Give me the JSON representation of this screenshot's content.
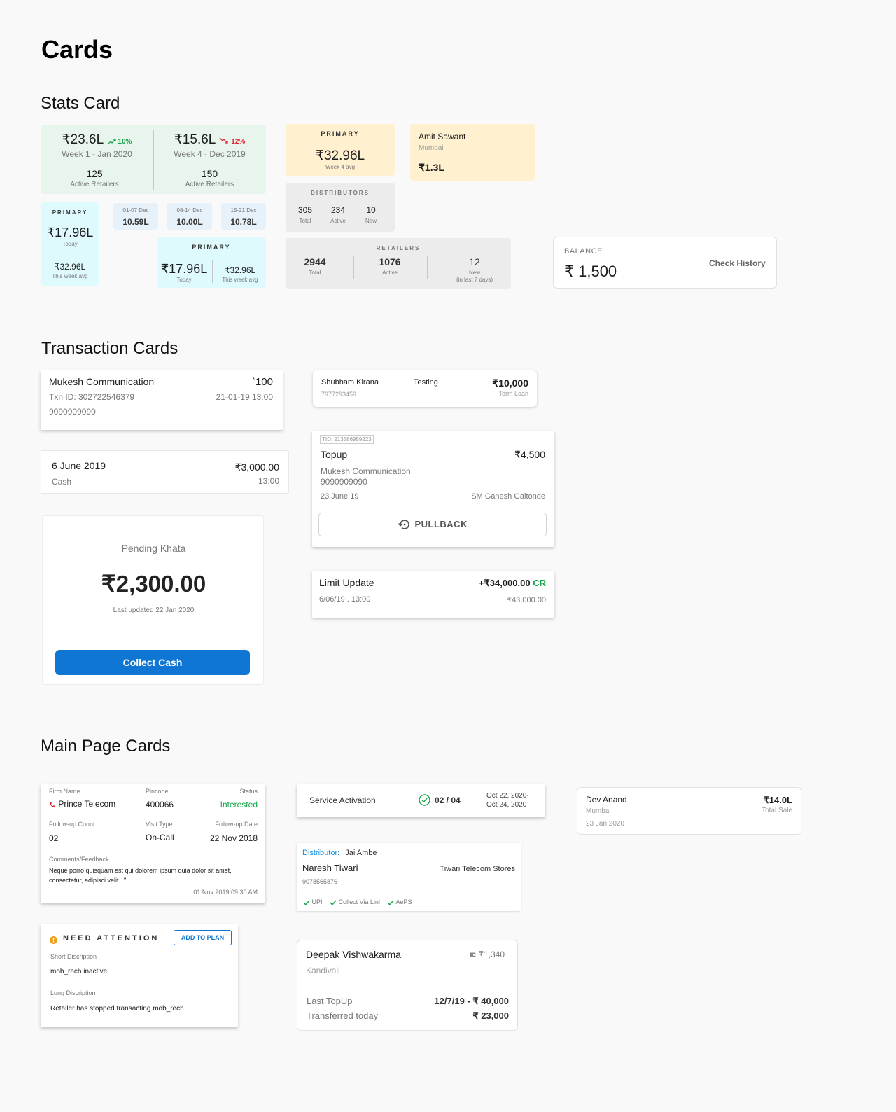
{
  "page": {
    "title": "Cards"
  },
  "sections": {
    "stats": "Stats Card",
    "transactions": "Transaction Cards",
    "main": "Main Page Cards"
  },
  "colors": {
    "accent": "#1076d3",
    "positive": "#14a348",
    "negative": "#e0202f"
  },
  "stats": {
    "week_compare": {
      "left": {
        "value": "₹23.6L",
        "delta": "10%",
        "period": "Week 1 - Jan 2020",
        "count": "125",
        "count_label": "Active Retailers"
      },
      "right": {
        "value": "₹15.6L",
        "delta": "12%",
        "period": "Week 4 - Dec 2019",
        "count": "150",
        "count_label": "Active Retailers"
      }
    },
    "primary_today": {
      "caption": "PRIMARY",
      "value": "₹17.96L",
      "sub": "Today",
      "avg_value": "₹32.96L",
      "avg_label": "This week avg"
    },
    "weekly_chips": [
      {
        "range": "01-07 Dec",
        "value": "10.59L"
      },
      {
        "range": "08-14 Dec",
        "value": "10.00L"
      },
      {
        "range": "15-21 Dec",
        "value": "10.78L"
      }
    ],
    "primary_compare": {
      "caption": "PRIMARY",
      "value": "₹17.96L",
      "sub": "Today",
      "avg_value": "₹32.96L",
      "avg_label": "This week avg"
    },
    "primary_week": {
      "caption": "PRIMARY",
      "value": "₹32.96L",
      "sub": "Week 4 avg"
    },
    "distributors": {
      "caption": "DISTRIBUTORS",
      "items": [
        {
          "value": "305",
          "label": "Total"
        },
        {
          "value": "234",
          "label": "Active"
        },
        {
          "value": "10",
          "label": "New"
        }
      ]
    },
    "retailers": {
      "caption": "RETAILERS",
      "items": [
        {
          "value": "2944",
          "label": "Total"
        },
        {
          "value": "1076",
          "label": "Active"
        },
        {
          "value": "12",
          "label": "New",
          "note": "(in last 7 days)"
        }
      ]
    },
    "person": {
      "name": "Amit Sawant",
      "city": "Mumbai",
      "value": "₹1.3L"
    },
    "balance": {
      "label": "BALANCE",
      "value": "₹ 1,500",
      "action": "Check History"
    }
  },
  "transactions": {
    "mukesh": {
      "name": "Mukesh Communication",
      "amount": "`100",
      "txn": "Txn ID: 302722546379",
      "time": "21-01-19 13:00",
      "phone": "9090909090"
    },
    "cash": {
      "date": "6 June 2019",
      "amount": "₹3,000.00",
      "mode": "Cash",
      "time": "13:00"
    },
    "khata": {
      "title": "Pending Khata",
      "amount": "₹2,300.00",
      "updated": "Last updated 22 Jan 2020",
      "button": "Collect Cash"
    },
    "shubham": {
      "name": "Shubham Kirana",
      "tag": "Testing",
      "amount": "₹10,000",
      "phone": "7977293459",
      "type": "Term Loan"
    },
    "topup": {
      "tid": "TID: 213586959223",
      "title": "Topup",
      "amount": "₹4,500",
      "firm": "Mukesh Communication",
      "phone": "9090909090",
      "date": "23 June 19",
      "sm": "SM Ganesh Gaitonde",
      "button": "PULLBACK"
    },
    "limit": {
      "title": "Limit Update",
      "amount": "+₹34,000.00",
      "cr": "CR",
      "date": "6/06/19 . 13:00",
      "balance": "₹43,000.00"
    }
  },
  "main": {
    "lead": {
      "firm_label": "Firm Name",
      "firm": "Prince Telecom",
      "pin_label": "Pincode",
      "pin": "400066",
      "status_label": "Status",
      "status": "Interested",
      "fc_label": "Follow-up Count",
      "fc": "02",
      "vt_label": "Visit Type",
      "vt": "On-Call",
      "fd_label": "Follow-up Date",
      "fd": "22 Nov 2018",
      "comments_label": "Comments/Feedback",
      "comments": "Neque porro quisquam est qui dolorem ipsum quia dolor sit amet, consectetur, adipisci velit...\"",
      "timestamp": "01 Nov 2019 09:30 AM"
    },
    "attention": {
      "title": "NEED ATTENTION",
      "button": "ADD TO PLAN",
      "short_label": "Short Discription",
      "short": "mob_rech inactive",
      "long_label": "Long Discription",
      "long": "Retailer has stopped transacting mob_rech."
    },
    "service": {
      "label": "Service Activation",
      "progress": "02 / 04",
      "date_from": "Oct 22, 2020-",
      "date_to": "Oct 24, 2020"
    },
    "distributor": {
      "label": "Distributor:",
      "name": "Jai Ambe",
      "retailer": "Naresh Tiwari",
      "phone": "9078565876",
      "store": "Tiwari Telecom Stores",
      "features": [
        "UPI",
        "Collect Via Linl",
        "AePS"
      ]
    },
    "deepak": {
      "name": "Deepak Vishwakarma",
      "wallet": "₹1,340",
      "area": "Kandivali",
      "l1": "Last TopUp",
      "v1": "12/7/19 - ₹ 40,000",
      "l2": "Transferred today",
      "v2": "₹ 23,000"
    },
    "dev": {
      "name": "Dev Anand",
      "amount": "₹14.0L",
      "city": "Mumbai",
      "label": "Total Sale",
      "date": "23 Jan 2020"
    }
  }
}
